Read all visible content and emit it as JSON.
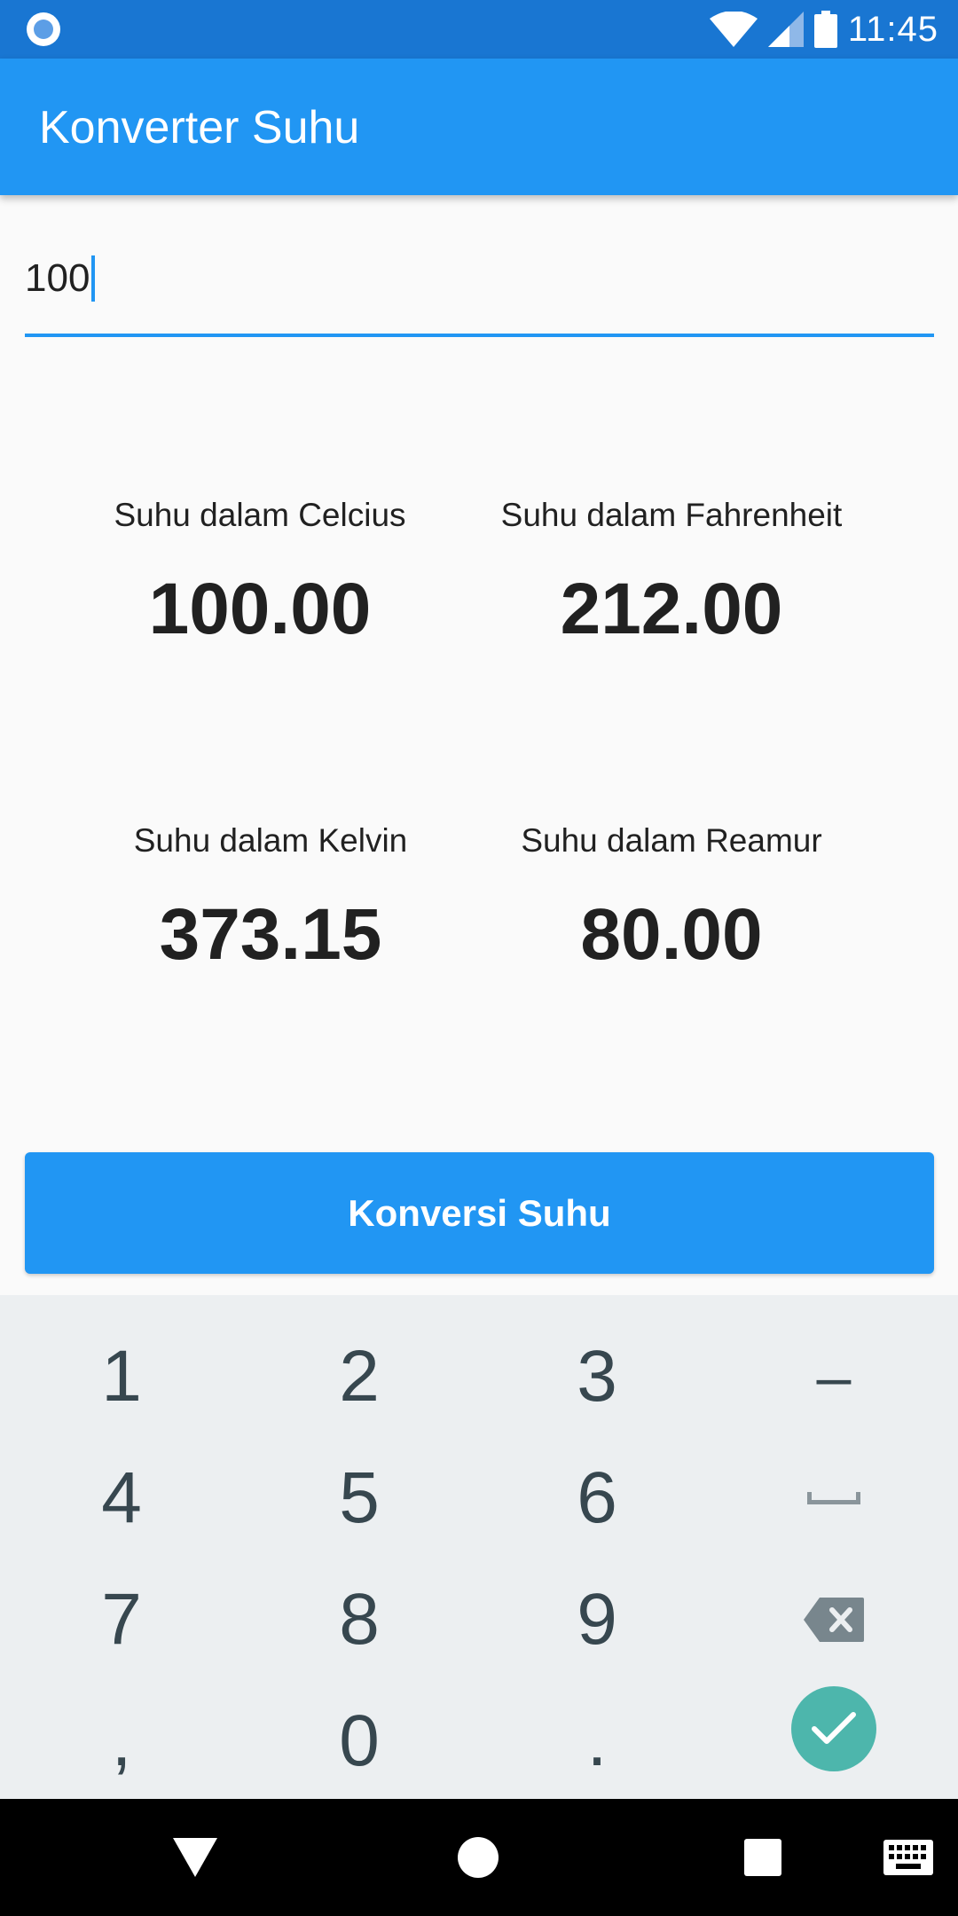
{
  "status_bar": {
    "time": "11:45",
    "left_icon": "sync-circle-icon",
    "icons": [
      "wifi-icon",
      "cell-signal-icon",
      "battery-icon"
    ]
  },
  "app_bar": {
    "title": "Konverter Suhu",
    "background": "#2196f3"
  },
  "input": {
    "value": "100"
  },
  "results": {
    "celsius": {
      "label": "Suhu dalam Celcius",
      "value": "100.00"
    },
    "fahrenheit": {
      "label": "Suhu dalam Fahrenheit",
      "value": "212.00"
    },
    "kelvin": {
      "label": "Suhu dalam Kelvin",
      "value": "373.15"
    },
    "reamur": {
      "label": "Suhu dalam Reamur",
      "value": "80.00"
    }
  },
  "convert_button": {
    "label": "Konversi Suhu"
  },
  "keyboard": {
    "rows": [
      [
        "1",
        "2",
        "3",
        "–"
      ],
      [
        "4",
        "5",
        "6",
        "space"
      ],
      [
        "7",
        "8",
        "9",
        "backspace"
      ],
      [
        ",",
        "0",
        ".",
        "done"
      ]
    ],
    "accent": "#4db6ac"
  },
  "nav_bar": {
    "icons": [
      "back-icon",
      "home-icon",
      "recents-icon",
      "keyboard-switch-icon"
    ]
  }
}
